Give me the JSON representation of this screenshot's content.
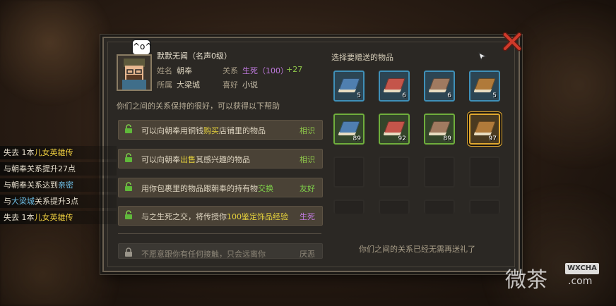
{
  "npc": {
    "name": "默默无闻（名声0级）",
    "emote": "^o^",
    "name_label": "姓名",
    "name_value": "朝奉",
    "relation_label": "关系",
    "relation_value": "生死（100）",
    "relation_delta": "+27",
    "home_label": "所属",
    "home_value": "大梁城",
    "hobby_label": "喜好",
    "hobby_value": "小说"
  },
  "summary": "你们之间的关系保持的很好，可以获得以下帮助",
  "benefits": [
    {
      "pre": "可以向朝奉用铜钱",
      "hl": "购买",
      "post": "店铺里的物品",
      "tier": "相识",
      "hl_color": "#e6d23c",
      "tier_color": "#8fc84a"
    },
    {
      "pre": "可以向朝奉",
      "hl": "出售",
      "post": "其感兴趣的物品",
      "tier": "相识",
      "hl_color": "#e6d23c",
      "tier_color": "#8fc84a"
    },
    {
      "pre": "用你包裹里的物品跟朝奉的持有物",
      "hl": "交换",
      "post": "",
      "tier": "友好",
      "hl_color": "#7fd24a",
      "tier_color": "#7fd24a"
    },
    {
      "pre": "与之生死之交，将传授你",
      "hl": "100鉴定饰品经验",
      "post": "",
      "tier": "生死",
      "hl_color": "#e6d23c",
      "tier_color": "#c07adf"
    }
  ],
  "locked_benefit": {
    "text": "不愿意跟你有任何接触，只会远离你",
    "tier": "厌恶"
  },
  "gift": {
    "title": "选择要赠送的物品",
    "items": [
      {
        "count": "5",
        "rarity": "blue",
        "book": "#4f7fb0"
      },
      {
        "count": "6",
        "rarity": "blue",
        "book": "#c4554a"
      },
      {
        "count": "6",
        "rarity": "blue",
        "book": "#a07a60"
      },
      {
        "count": "5",
        "rarity": "blue",
        "book": "#b07a3a"
      },
      {
        "count": "89",
        "rarity": "green",
        "book": "#4f7fb0"
      },
      {
        "count": "92",
        "rarity": "green",
        "book": "#c4554a"
      },
      {
        "count": "89",
        "rarity": "green",
        "book": "#a07a60"
      },
      {
        "count": "97",
        "rarity": "gold",
        "book": "#b07a3a"
      }
    ],
    "footer": "你们之间的关系已经无需再送礼了"
  },
  "log": [
    {
      "pre": "失去 1本",
      "hl": "儿女英雄传",
      "post": "",
      "hl_color": "#f0d040"
    },
    {
      "pre": "与朝奉关系提升",
      "hl": "",
      "post": "27点",
      "hl_color": "#f0d040"
    },
    {
      "pre": "与朝奉关系达到",
      "hl": "亲密",
      "post": "",
      "hl_color": "#6fc0e8"
    },
    {
      "pre": "与",
      "hl": "大梁城",
      "post": "关系提升3点",
      "hl_color": "#6fc0e8"
    },
    {
      "pre": "失去 1本",
      "hl": "儿女英雄传",
      "post": "",
      "hl_color": "#f0d040"
    }
  ],
  "watermark": {
    "logo_text": "微茶",
    "badge": "WXCHA",
    "domain": ".com"
  },
  "colors": {
    "relation": "#c07adf",
    "delta": "#8fc84a",
    "close": "#d03a2a"
  }
}
